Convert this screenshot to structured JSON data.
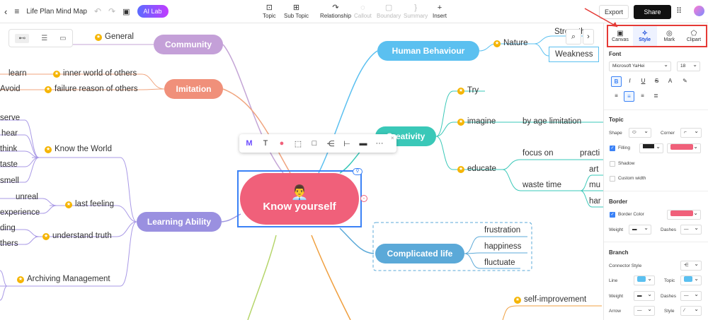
{
  "toolbar": {
    "title": "Life Plan Mind Map",
    "ai_lab": "AI Lab",
    "topic": "Topic",
    "sub_topic": "Sub Topic",
    "relationship": "Relationship",
    "callout": "Callout",
    "boundary": "Boundary",
    "summary": "Summary",
    "insert": "Insert",
    "export": "Export",
    "share": "Share"
  },
  "panel": {
    "tabs": [
      "Canvas",
      "Style",
      "Mark",
      "Clipart"
    ],
    "active_tab": "Style",
    "font_heading": "Font",
    "font_family": "Microsoft YaHei",
    "font_size": "18",
    "topic_heading": "Topic",
    "shape_label": "Shape",
    "corner_label": "Corner",
    "filling_label": "Filling",
    "shadow_label": "Shadow",
    "custom_width_label": "Custom width",
    "border_heading": "Border",
    "border_color_label": "Border Color",
    "weight_label": "Weight",
    "dashes_label": "Dashes",
    "branch_heading": "Branch",
    "connector_style_label": "Connector Style",
    "line_label": "Line",
    "topic_label": "Topic",
    "weight2_label": "Weight",
    "dashes2_label": "Dashes",
    "arrow_label": "Arrow",
    "style_label": "Style",
    "fill_color": "#f0607a",
    "line_color": "#5bc0f0"
  },
  "map": {
    "central": "Know yourself",
    "mains": {
      "community": "Community",
      "imitation": "Imitation",
      "learning": "Learning Ability",
      "human": "Human Behaviour",
      "creativity": "Creativity",
      "complicated": "Complicated life"
    },
    "labels": {
      "general": "General",
      "learn": "learn",
      "inner": "inner world of others",
      "avoid": "Avoid",
      "failure": "failure reason of others",
      "serve": "serve",
      "hear": "hear",
      "think": "think",
      "know_world": "Know the World",
      "taste": "taste",
      "smell": "smell",
      "unreal": "unreal",
      "last_feeling": "last feeling",
      "experience": "experience",
      "ding": "ding",
      "understand": "understand truth",
      "thers": "thers",
      "archiving": "Archiving Management",
      "nature": "Nature",
      "strength": "Strength",
      "weakness": "Weakness",
      "try": "Try",
      "imagine": "imagine",
      "by_age": "by age limitation",
      "educate": "educate",
      "focus_on": "focus on",
      "practi": "practi",
      "art": "art",
      "waste_time": "waste time",
      "mu": "mu",
      "har": "har",
      "frustration": "frustration",
      "happiness": "happiness",
      "fluctuate": "fluctuate",
      "self_improvement": "self-improvement"
    }
  }
}
